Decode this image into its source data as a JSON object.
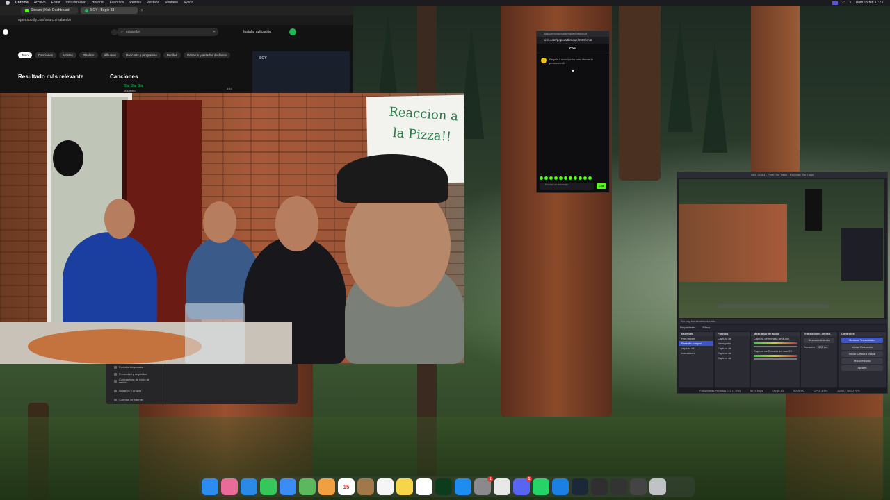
{
  "menubar": {
    "app": "Chrome",
    "items": [
      "Archivo",
      "Editar",
      "Visualización",
      "Historial",
      "Favoritos",
      "Perfiles",
      "Pestaña",
      "Ventana",
      "Ayuda"
    ],
    "clock": "Dom 15 feb 11:23"
  },
  "browser": {
    "tabs": [
      {
        "label": "Stream | Kick Dashboard"
      },
      {
        "label": "SOY | Bogie 33"
      }
    ],
    "url": "open.spotify.com/search/malaedro",
    "search": {
      "value": "malaedro"
    },
    "install_label": "Instalar aplicación",
    "chips": [
      "Todo",
      "Canciones",
      "Artistas",
      "Playlists",
      "Álbumes",
      "Podcasts y programas",
      "Perfiles",
      "Géneros y estados de ánimo"
    ],
    "top_result_heading": "Resultado más relevante",
    "songs_heading": "Canciones",
    "song_title": "Bla, Bla, Bla",
    "song_artist": "Malaedro",
    "song_duration": "3:47",
    "now_playing_title": "SOY"
  },
  "webcam": {
    "sign_text": "Reaccion a la Pizza!!"
  },
  "dropdown": {
    "items": [
      "Pantalla bloqueada",
      "Privacidad y seguridad",
      "Contraseñas de inicio de sesión",
      "Usuarios y grupos",
      "Cuentas de Internet"
    ]
  },
  "kick_chat": {
    "window_url": "kick.com/popout/tbmquel6969/chat",
    "url": "kick.com/popout/tbmquel6969/chat",
    "heading": "Chat",
    "note": "Regala 1 suscripción para liberar la promoción 1",
    "input_placeholder": "Enviar un mensaje",
    "send_label": "Chat"
  },
  "obs": {
    "title": "OBS 32.0.4 - Perfil: Sin Título - Escenas: Sin Título",
    "status": "No hay fuente seleccionada",
    "props_label": "Propiedades",
    "filters_label": "Filtros",
    "scenes_heading": "Escenas",
    "scenes": [
      "Pre Stream",
      "Pantalla compar",
      "captura kit",
      "reacciones"
    ],
    "sources_heading": "Fuentes",
    "sources": [
      "Captura de",
      "Navegador",
      "Captura de",
      "Captura de",
      "Captura de"
    ],
    "mixer_heading": "Mezclador de audio",
    "mixer_tracks": [
      "Captura de entrada de audio",
      "Captura de Entrada de macOS"
    ],
    "transitions_heading": "Transiciones de esc.",
    "transition_value": "Desvanecimiento",
    "duration_label": "Duración",
    "duration_value": "300 ms",
    "controls_heading": "Controles",
    "controls": [
      "Detener Transmisión",
      "Iniciar Grabación",
      "Iniciar Cámara Virtual",
      "Modo estudio",
      "Ajustes"
    ],
    "footer": [
      "Fotogramas Perdidos 271 (1.0%)",
      "5079 kbps",
      "00:10:13",
      "00:00:00",
      "CPU: 4.5%",
      "30.00 / 30.00 FPS"
    ]
  },
  "dock": {
    "apps": [
      {
        "name": "Finder",
        "color": "#2d8cf0"
      },
      {
        "name": "Launchpad",
        "color": "#e86b9a"
      },
      {
        "name": "Safari",
        "color": "#2b8ae6"
      },
      {
        "name": "Messages",
        "color": "#35c759"
      },
      {
        "name": "Mail",
        "color": "#3b8cf5"
      },
      {
        "name": "Maps",
        "color": "#5cb85c"
      },
      {
        "name": "Photos",
        "color": "#f0a040"
      },
      {
        "name": "Calendar",
        "color": "#ffffff",
        "text": "15"
      },
      {
        "name": "Notes brown",
        "color": "#a0784a"
      },
      {
        "name": "Reminders",
        "color": "#f5f5f5"
      },
      {
        "name": "Notes",
        "color": "#f7d54a"
      },
      {
        "name": "Freeform",
        "color": "#ffffff"
      },
      {
        "name": "Books",
        "color": "#0c3c1c"
      },
      {
        "name": "App Store",
        "color": "#1e8cf0"
      },
      {
        "name": "System Settings",
        "color": "#8a8a8e",
        "badge": "1"
      },
      {
        "name": "Chrome",
        "color": "#e8e8e8"
      },
      {
        "name": "Discord",
        "color": "#5865f2",
        "badge": "1"
      },
      {
        "name": "WhatsApp",
        "color": "#25d366"
      },
      {
        "name": "Bluetooth",
        "color": "#1c7fe3"
      },
      {
        "name": "Steam",
        "color": "#1b2838"
      },
      {
        "name": "OBS",
        "color": "#302e31"
      },
      {
        "name": "Window1",
        "color": "#333333"
      },
      {
        "name": "Window2",
        "color": "#444444"
      },
      {
        "name": "Trash",
        "color": "#bfc3c6"
      }
    ]
  }
}
